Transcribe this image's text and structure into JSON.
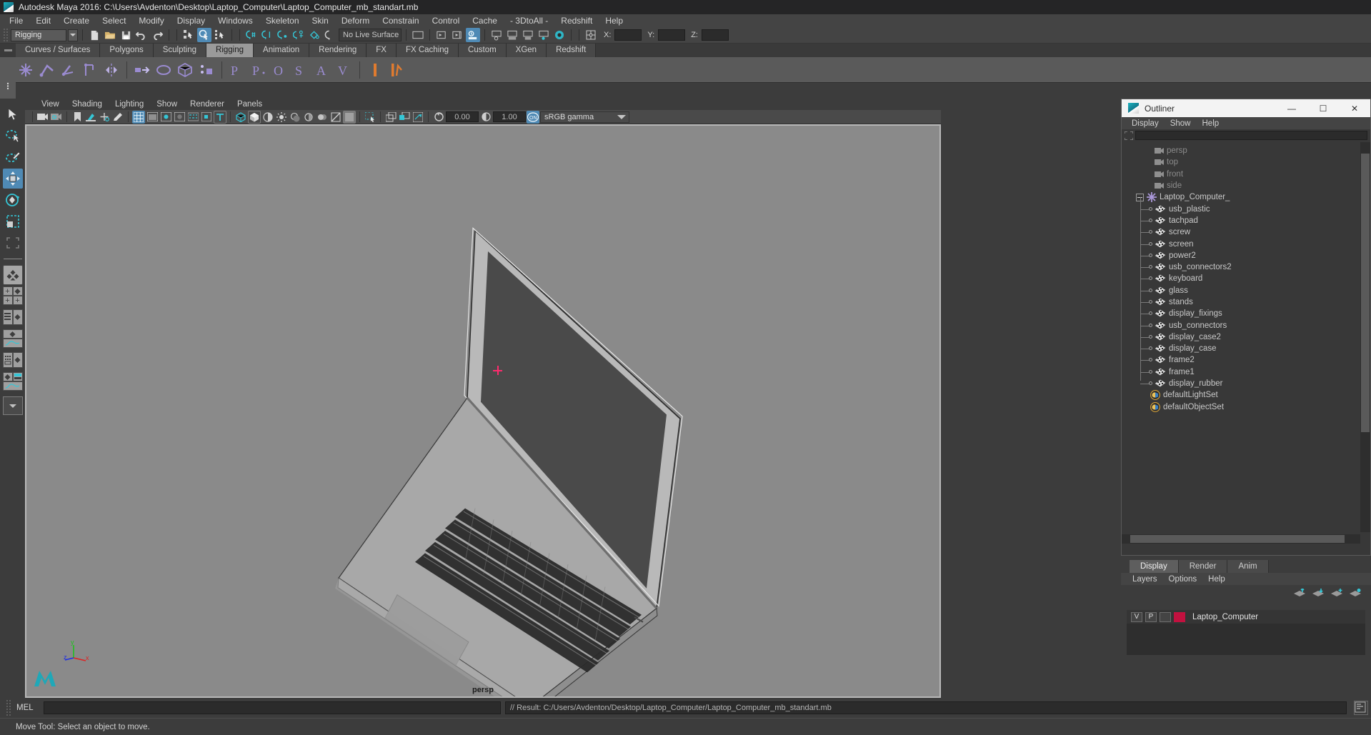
{
  "window": {
    "title": "Autodesk Maya 2016: C:\\Users\\Avdenton\\Desktop\\Laptop_Computer\\Laptop_Computer_mb_standart.mb"
  },
  "menubar": {
    "items": [
      "File",
      "Edit",
      "Create",
      "Select",
      "Modify",
      "Display",
      "Windows",
      "Skeleton",
      "Skin",
      "Deform",
      "Constrain",
      "Control",
      "Cache",
      "- 3DtoAll -",
      "Redshift",
      "Help"
    ]
  },
  "statusline": {
    "menu_set": "Rigging",
    "live_surface": "No Live Surface",
    "coord_x_label": "X:",
    "coord_y_label": "Y:",
    "coord_z_label": "Z:",
    "coord_x_value": "",
    "coord_y_value": "",
    "coord_z_value": ""
  },
  "shelf": {
    "tabs": [
      "Curves / Surfaces",
      "Polygons",
      "Sculpting",
      "Rigging",
      "Animation",
      "Rendering",
      "FX",
      "FX Caching",
      "Custom",
      "XGen",
      "Redshift"
    ],
    "selected": "Rigging"
  },
  "viewport": {
    "panel_menu": [
      "View",
      "Shading",
      "Lighting",
      "Show",
      "Renderer",
      "Panels"
    ],
    "exposure_value": "0.00",
    "gamma_value": "1.00",
    "color_management": "sRGB gamma",
    "camera_label": "persp",
    "axis_x": "x",
    "axis_y": "y",
    "axis_z": "z"
  },
  "outliner": {
    "title": "Outliner",
    "window_buttons": {
      "minimize": "—",
      "maximize": "☐",
      "close": "✕"
    },
    "menu": [
      "Display",
      "Show",
      "Help"
    ],
    "search_value": "",
    "items": [
      {
        "label": "persp",
        "icon": "camera-icon",
        "depth": 1,
        "kind": "camera"
      },
      {
        "label": "top",
        "icon": "camera-icon",
        "depth": 1,
        "kind": "camera"
      },
      {
        "label": "front",
        "icon": "camera-icon",
        "depth": 1,
        "kind": "camera"
      },
      {
        "label": "side",
        "icon": "camera-icon",
        "depth": 1,
        "kind": "camera"
      },
      {
        "label": "Laptop_Computer_",
        "icon": "group-icon",
        "depth": 0,
        "kind": "group",
        "expanded": true
      },
      {
        "label": "usb_plastic",
        "icon": "mesh-icon",
        "depth": 2,
        "kind": "mesh"
      },
      {
        "label": "tachpad",
        "icon": "mesh-icon",
        "depth": 2,
        "kind": "mesh"
      },
      {
        "label": "screw",
        "icon": "mesh-icon",
        "depth": 2,
        "kind": "mesh"
      },
      {
        "label": "screen",
        "icon": "mesh-icon",
        "depth": 2,
        "kind": "mesh"
      },
      {
        "label": "power2",
        "icon": "mesh-icon",
        "depth": 2,
        "kind": "mesh"
      },
      {
        "label": "usb_connectors2",
        "icon": "mesh-icon",
        "depth": 2,
        "kind": "mesh"
      },
      {
        "label": "keyboard",
        "icon": "mesh-icon",
        "depth": 2,
        "kind": "mesh"
      },
      {
        "label": "glass",
        "icon": "mesh-icon",
        "depth": 2,
        "kind": "mesh"
      },
      {
        "label": "stands",
        "icon": "mesh-icon",
        "depth": 2,
        "kind": "mesh"
      },
      {
        "label": "display_fixings",
        "icon": "mesh-icon",
        "depth": 2,
        "kind": "mesh"
      },
      {
        "label": "usb_connectors",
        "icon": "mesh-icon",
        "depth": 2,
        "kind": "mesh"
      },
      {
        "label": "display_case2",
        "icon": "mesh-icon",
        "depth": 2,
        "kind": "mesh"
      },
      {
        "label": "display_case",
        "icon": "mesh-icon",
        "depth": 2,
        "kind": "mesh"
      },
      {
        "label": "frame2",
        "icon": "mesh-icon",
        "depth": 2,
        "kind": "mesh"
      },
      {
        "label": "frame1",
        "icon": "mesh-icon",
        "depth": 2,
        "kind": "mesh"
      },
      {
        "label": "display_rubber",
        "icon": "mesh-icon",
        "depth": 2,
        "kind": "mesh"
      },
      {
        "label": "defaultLightSet",
        "icon": "set-icon",
        "depth": 1,
        "kind": "set"
      },
      {
        "label": "defaultObjectSet",
        "icon": "set-icon",
        "depth": 1,
        "kind": "set"
      }
    ]
  },
  "layer_editor": {
    "tabs": [
      "Display",
      "Render",
      "Anim"
    ],
    "selected_tab": "Display",
    "menu": [
      "Layers",
      "Options",
      "Help"
    ],
    "layers": [
      {
        "visibility": "V",
        "playback": "P",
        "shading": "",
        "color": "#c2113f",
        "name": "Laptop_Computer"
      }
    ]
  },
  "command_line": {
    "language": "MEL",
    "input_value": "",
    "result": "// Result: C:/Users/Avdenton/Desktop/Laptop_Computer/Laptop_Computer_mb_standart.mb"
  },
  "help_line": {
    "text": "Move Tool: Select an object to move."
  },
  "colors": {
    "accent_blue": "#4f8ab5",
    "teal": "#35c6d6",
    "layer_red": "#c2113f",
    "crosshair_pink": "#ff2b6e",
    "axis_x": "#e02020",
    "axis_y": "#1fc11f",
    "axis_z": "#2030e0"
  }
}
